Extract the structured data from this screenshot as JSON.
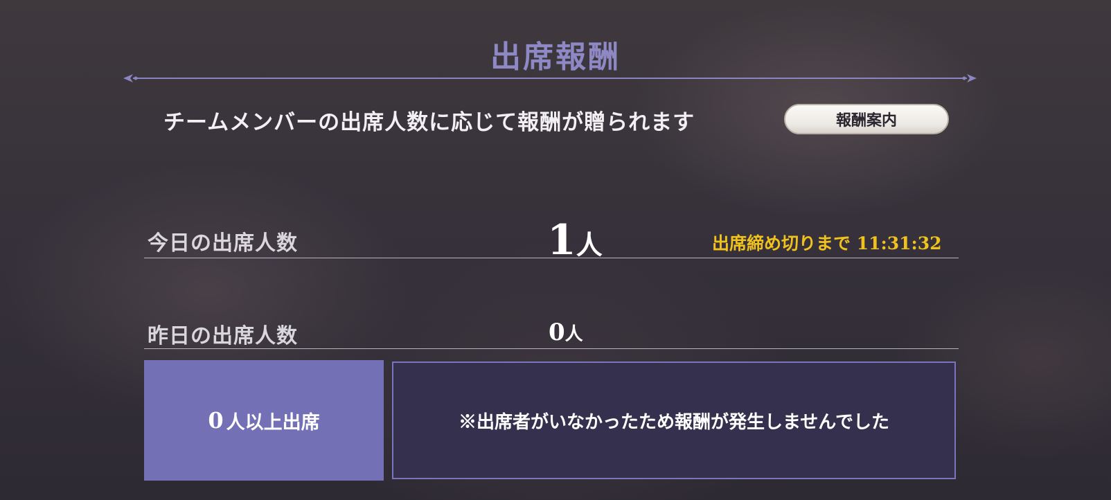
{
  "header": {
    "title": "出席報酬"
  },
  "subtitle": "チームメンバーの出席人数に応じて報酬が贈られます",
  "guide_button": {
    "label": "報酬案内"
  },
  "today": {
    "label": "今日の出席人数",
    "count": "1",
    "unit": "人",
    "deadline_label": "出席締め切りまで",
    "deadline_time": "11:31:32"
  },
  "yesterday": {
    "label": "昨日の出席人数",
    "count": "0",
    "unit": "人"
  },
  "reward": {
    "tier_count": "0",
    "tier_text": "人以上出席",
    "notice": "※出席者がいなかったため報酬が発生しませんでした"
  },
  "colors": {
    "title": "#8e89c4",
    "deadline": "#f0c21e",
    "tier_box": "#7470b5",
    "notice_box": "#35304d"
  }
}
